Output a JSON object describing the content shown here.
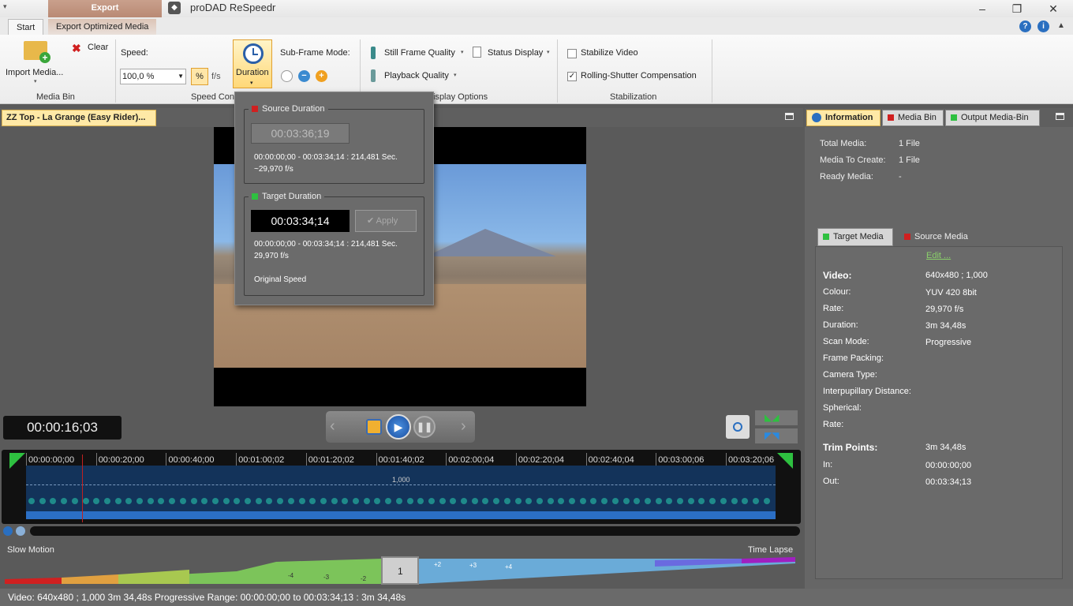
{
  "titlebar": {
    "context_tab": "Export",
    "app_title": "proDAD ReSpeedr"
  },
  "ribbon_tabs": {
    "start": "Start",
    "export_optimized": "Export Optimized Media"
  },
  "ribbon": {
    "import_media": "Import Media...",
    "clear": "Clear",
    "media_bin_group": "Media Bin",
    "speed_label": "Speed:",
    "speed_value": "100,0 %",
    "pct": "%",
    "fps": "f/s",
    "duration": "Duration",
    "speed_group": "Speed Con",
    "subframe_label": "Sub-Frame Mode:",
    "still_frame_quality": "Still Frame Quality",
    "status_display": "Status Display",
    "playback_quality": "Playback Quality",
    "display_group": "isplay Options",
    "stabilize_video": "Stabilize Video",
    "rolling_shutter": "Rolling-Shutter Compensation",
    "stabilization_group": "Stabilization",
    "rolling_checked": "✓"
  },
  "clip_tab": "ZZ Top - La Grange (Easy Rider)...",
  "duration_popup": {
    "source_title": "Source Duration",
    "source_value": "00:03:36;19",
    "source_range": "00:00:00;00 - 00:03:34;14 : 214,481 Sec.",
    "source_fps": "~29,970 f/s",
    "target_title": "Target Duration",
    "target_value": "00:03:34;14",
    "apply": "Apply",
    "target_range": "00:00:00;00 - 00:03:34;14 : 214,481 Sec.",
    "target_fps": "29,970 f/s",
    "original_speed": "Original Speed"
  },
  "timecode": "00:00:16;03",
  "timeline": {
    "ticks": [
      "00:00:00;00",
      "00:00:20;00",
      "00:00:40;00",
      "00:01:00;02",
      "00:01:20;02",
      "00:01:40;02",
      "00:02:00;04",
      "00:02:20;04",
      "00:02:40;04",
      "00:03:00;06",
      "00:03:20;06"
    ],
    "speed_marker": "1,000"
  },
  "speed_curve": {
    "slow": "Slow Motion",
    "fast": "Time Lapse",
    "labels": [
      "-4",
      "-3",
      "-2",
      "1",
      "+2",
      "+3",
      "+4"
    ]
  },
  "status": "Video: 640x480 ; 1,000  3m 34,48s  Progressive  Range: 00:00:00;00 to 00:03:34;13 : 3m 34,48s",
  "right_tabs": {
    "information": "Information",
    "media_bin": "Media Bin",
    "output": "Output Media-Bin"
  },
  "info": {
    "total_label": "Total Media:",
    "total_value": "1 File",
    "create_label": "Media To Create:",
    "create_value": "1 File",
    "ready_label": "Ready Media:",
    "ready_value": "-"
  },
  "sub_tabs": {
    "target": "Target Media",
    "source": "Source Media"
  },
  "media": {
    "edit": "Edit ...",
    "rows": [
      {
        "k": "Video:",
        "v": "640x480 ; 1,000"
      },
      {
        "k": "Colour:",
        "v": "YUV 420 8bit"
      },
      {
        "k": "Rate:",
        "v": "29,970 f/s"
      },
      {
        "k": "Duration:",
        "v": "3m 34,48s"
      },
      {
        "k": "Scan Mode:",
        "v": "Progressive"
      },
      {
        "k": "Frame Packing:",
        "v": ""
      },
      {
        "k": "Camera Type:",
        "v": ""
      },
      {
        "k": "Interpupillary Distance:",
        "v": ""
      },
      {
        "k": "Spherical:",
        "v": ""
      },
      {
        "k": "Rate:",
        "v": ""
      },
      {
        "k": "Trim Points:",
        "v": "3m 34,48s"
      },
      {
        "k": "In:",
        "v": "00:00:00;00"
      },
      {
        "k": "Out:",
        "v": "00:03:34;13"
      }
    ]
  },
  "colors": {
    "accent": "#ffd878",
    "track": "#13335a",
    "playhead": "#c02020"
  }
}
